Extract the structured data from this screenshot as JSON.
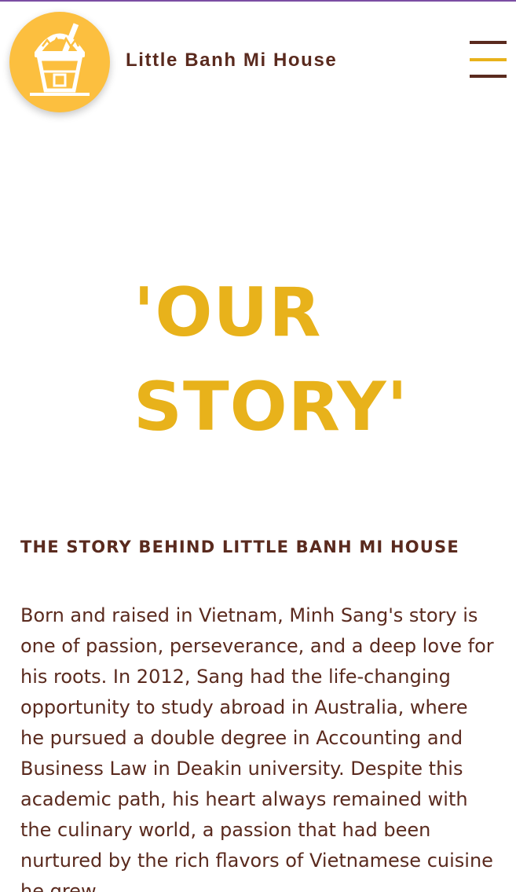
{
  "header": {
    "brand_name": "Little Banh Mi House",
    "logo_icon": "banh-mi-drink-cup-logo",
    "menu_icon": "hamburger-menu-icon"
  },
  "hero": {
    "title_line1": "'OUR",
    "title_line2": "STORY'"
  },
  "story": {
    "heading": "THE STORY BEHIND LITTLE BANH MI HOUSE",
    "body": "Born and raised in Vietnam, Minh Sang's story is one of passion, perseverance, and a deep love for his roots. In 2012, Sang had the life-changing opportunity to study abroad in Australia, where he pursued a double degree in Accounting and Business Law in Deakin university. Despite this academic path, his heart always remained with the culinary world, a passion that had been nurtured by the rich flavors of Vietnamese cuisine he grew"
  },
  "colors": {
    "accent_yellow": "#e8b21b",
    "logo_yellow": "#fcbf3f",
    "brand_brown": "#5a2a1e",
    "top_border_purple": "#7b4ea3"
  }
}
